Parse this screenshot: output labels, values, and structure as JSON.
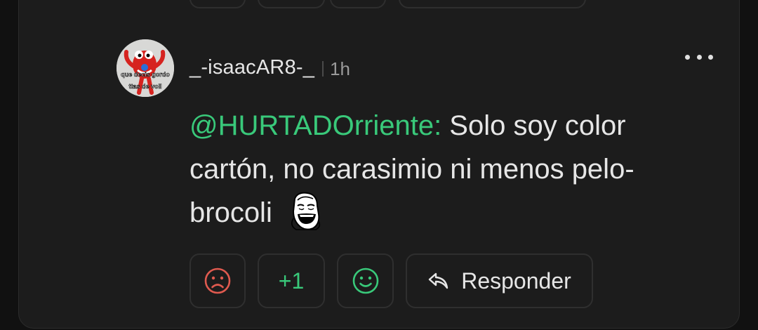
{
  "comment": {
    "username": "_-isaacAR8-_",
    "time": "1h",
    "mention": "@HURTADOrriente:",
    "text": " Solo soy color cartón, no carasimio ni menos pelo-brocoli",
    "avatar_caption_top": "que decis gordo",
    "avatar_caption_bottom": "ttas de voll",
    "meme_emoji_icon": "laughing-meme-face-icon"
  },
  "actions": {
    "dislike_icon": "sad-face-icon",
    "score": "+1",
    "like_icon": "happy-face-icon",
    "reply_icon": "reply-arrow-icon",
    "reply_label": "Responder",
    "more_icon": "more-dots-icon"
  },
  "colors": {
    "background": "#111111",
    "card": "#1c1c1c",
    "accent_green": "#39c97a",
    "dislike_red": "#e05a4f",
    "text": "#e6e6e6",
    "muted": "#9a9a9a"
  }
}
